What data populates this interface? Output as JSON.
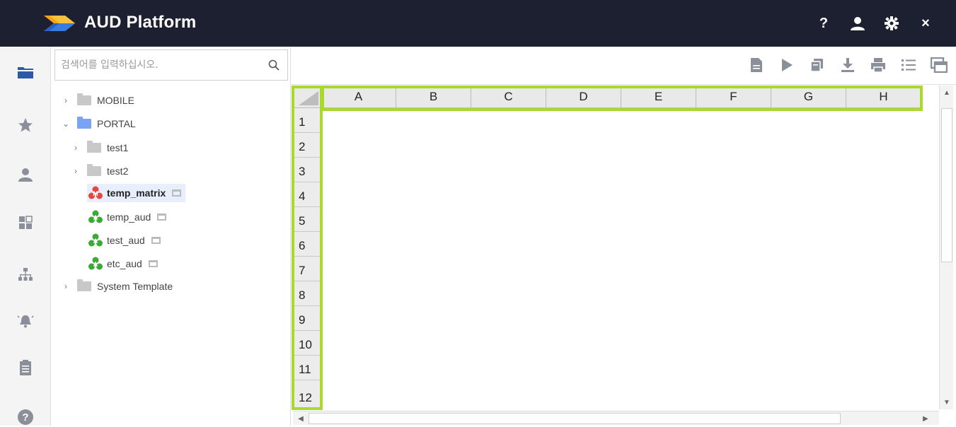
{
  "header": {
    "title": "AUD Platform",
    "help_label": "?",
    "close_label": "×"
  },
  "rail": {
    "items": [
      {
        "icon": "folder-icon",
        "active": true
      },
      {
        "icon": "star-icon"
      },
      {
        "icon": "user-icon"
      },
      {
        "icon": "dashboard-icon"
      },
      {
        "icon": "hierarchy-icon"
      },
      {
        "icon": "alarm-icon"
      },
      {
        "icon": "clipboard-icon"
      },
      {
        "icon": "help-icon"
      }
    ]
  },
  "search": {
    "placeholder": "검색어를 입력하십시오."
  },
  "tree": {
    "items": [
      {
        "label": "MOBILE",
        "type": "folder"
      },
      {
        "label": "PORTAL",
        "type": "folder",
        "expanded": true
      },
      {
        "label": "test1",
        "type": "folder"
      },
      {
        "label": "test2",
        "type": "folder"
      },
      {
        "label": "temp_matrix",
        "type": "matrix-report",
        "selected": true
      },
      {
        "label": "temp_aud",
        "type": "aud-report"
      },
      {
        "label": "test_aud",
        "type": "aud-report"
      },
      {
        "label": "etc_aud",
        "type": "aud-report"
      },
      {
        "label": "System Template",
        "type": "folder"
      }
    ]
  },
  "toolbar": {
    "icons": [
      "new-document-icon",
      "run-icon",
      "copy-icon",
      "download-icon",
      "print-icon",
      "list-icon",
      "window-icon"
    ]
  },
  "grid": {
    "columns": [
      "A",
      "B",
      "C",
      "D",
      "E",
      "F",
      "G",
      "H"
    ],
    "rows": [
      "1",
      "2",
      "3",
      "4",
      "5",
      "6",
      "7",
      "8",
      "9",
      "10",
      "11",
      "12"
    ]
  },
  "colors": {
    "header_bg": "#1d2030",
    "highlight": "#a9d92d",
    "selected_row": "#e8eefb",
    "matrix_icon": "#e8453c",
    "aud_icon": "#3aa935",
    "portal_folder": "#7aa3f5",
    "folder": "#c8c8c8"
  }
}
